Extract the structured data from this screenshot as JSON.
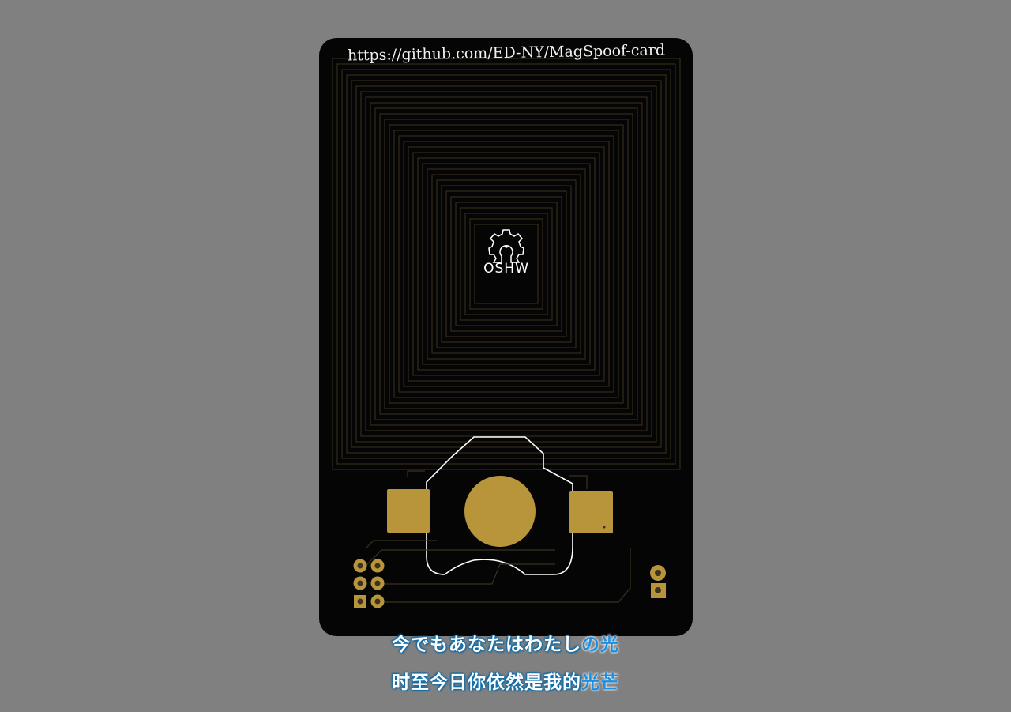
{
  "pcb": {
    "url_text": "https://github.com/ED-NY/MagSpoof-card",
    "oshw_label": "OSHW",
    "colors": {
      "background": "#808080",
      "board": "#050505",
      "trace": "#3a3320",
      "pad": "#b8953a",
      "silkscreen": "#ffffff"
    }
  },
  "subtitles": {
    "line1": {
      "main": "今でもあなたはわたし",
      "highlight": "の光"
    },
    "line2": {
      "main": "时至今日你依然是我的",
      "highlight": "光芒"
    }
  }
}
